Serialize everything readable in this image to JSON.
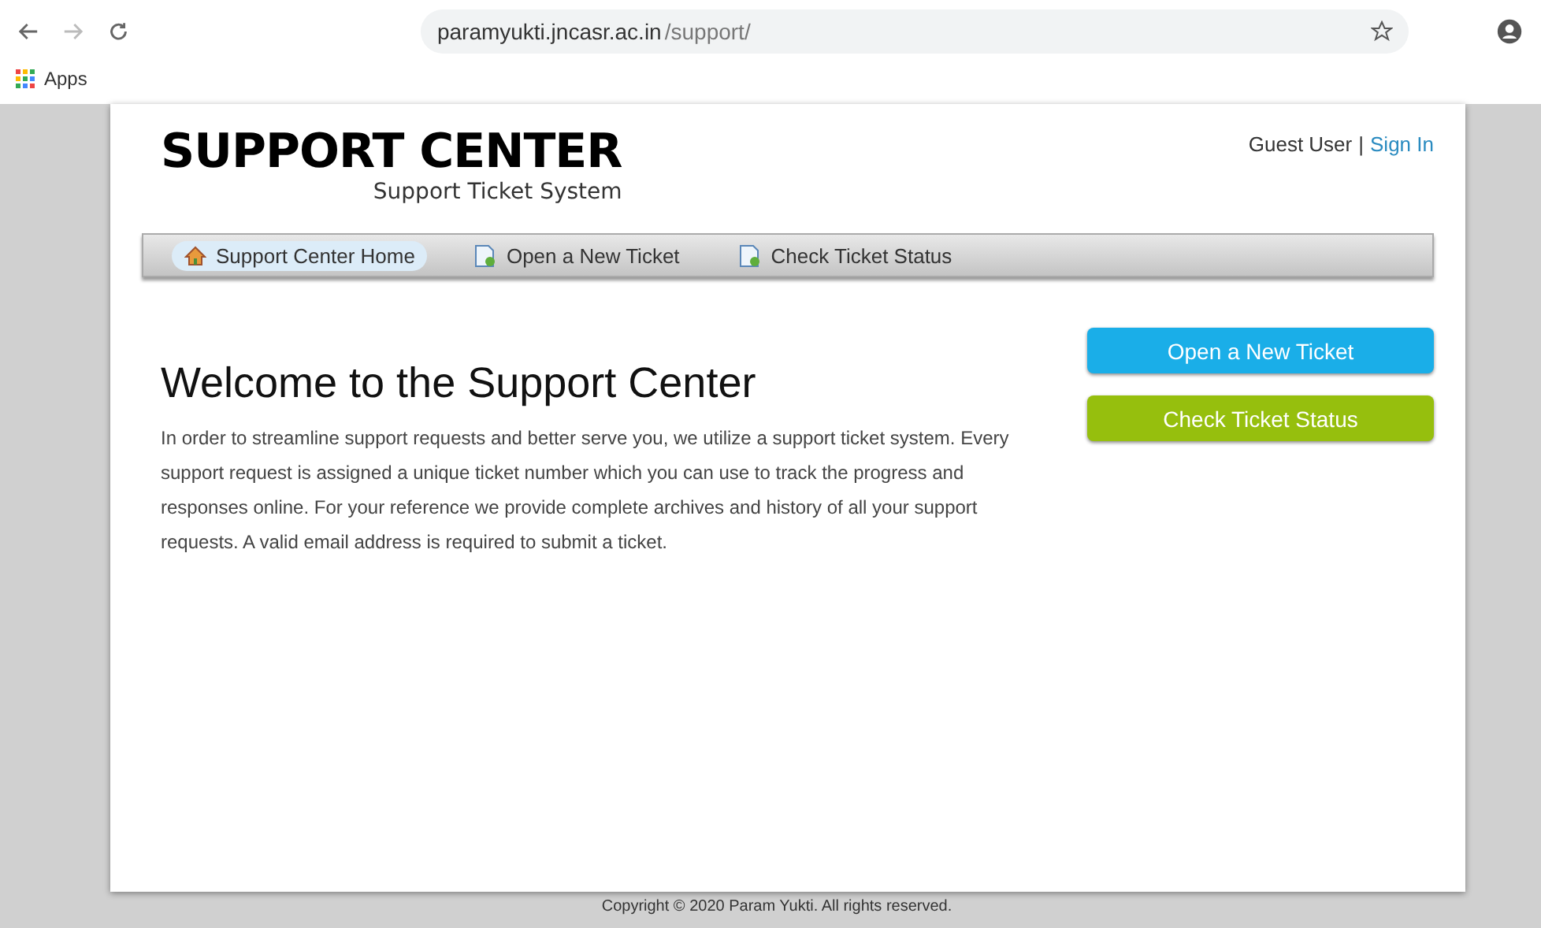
{
  "browser": {
    "url_host": "paramyukti.jncasr.ac.in",
    "url_path": "/support/",
    "bookmarks": [
      {
        "label": "Apps"
      }
    ]
  },
  "header": {
    "logo_title": "SUPPORT CENTER",
    "logo_subtitle": "Support Ticket System",
    "user": "Guest User",
    "separator": "|",
    "sign_in": "Sign In"
  },
  "nav": [
    {
      "label": "Support Center Home",
      "kind": "home",
      "selected": true
    },
    {
      "label": "Open a New Ticket",
      "kind": "new",
      "selected": false
    },
    {
      "label": "Check Ticket Status",
      "kind": "status",
      "selected": false
    }
  ],
  "main": {
    "heading": "Welcome to the Support Center",
    "text": "In order to streamline support requests and better serve you, we utilize a support ticket system. Every support request is assigned a unique ticket number which you can use to track the progress and responses online. For your reference we provide complete archives and history of all your support requests. A valid email address is required to submit a ticket."
  },
  "actions": [
    {
      "label": "Open a New Ticket",
      "color": "#1aaee8"
    },
    {
      "label": "Check Ticket Status",
      "color": "#96bf0d"
    }
  ],
  "footer": "Copyright © 2020 Param Yukti. All rights reserved."
}
